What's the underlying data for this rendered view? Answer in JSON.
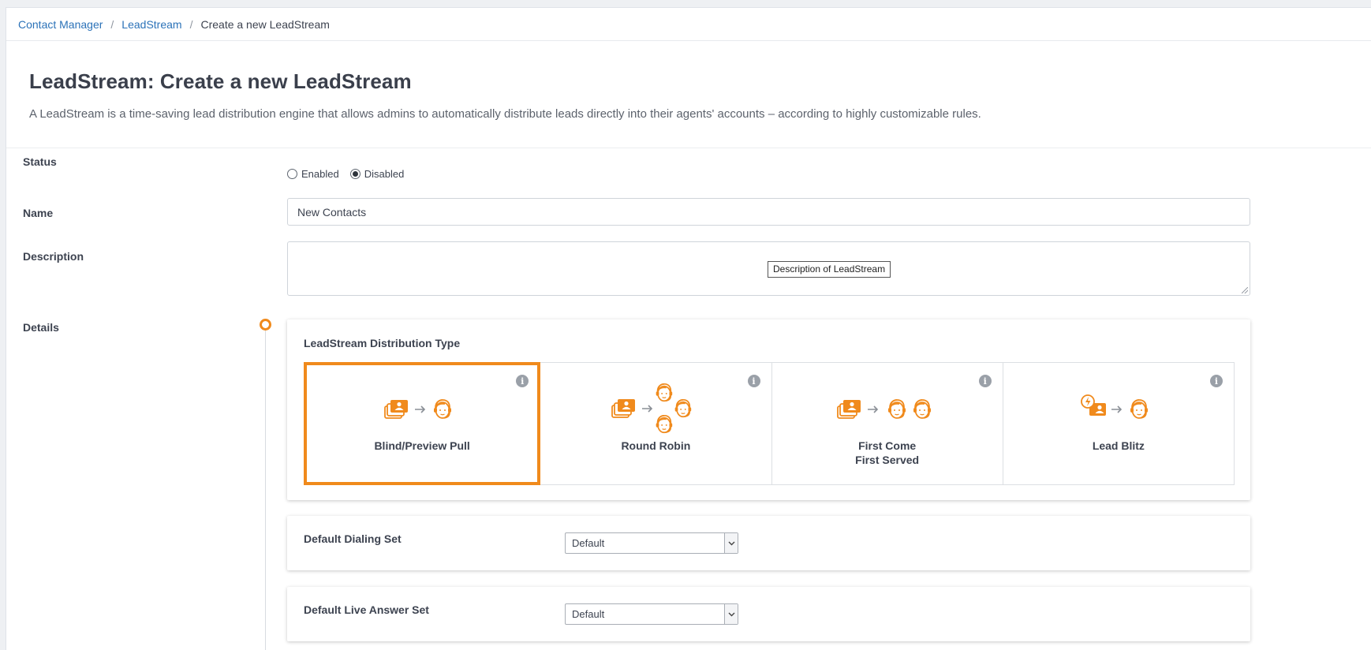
{
  "breadcrumb": {
    "items": [
      "Contact Manager",
      "LeadStream"
    ],
    "current": "Create a new LeadStream"
  },
  "header": {
    "title": "LeadStream: Create a new LeadStream",
    "description": "A LeadStream is a time-saving lead distribution engine that allows admins to automatically distribute leads directly into their agents' accounts – according to highly customizable rules."
  },
  "form": {
    "status": {
      "label": "Status",
      "options": [
        "Enabled",
        "Disabled"
      ],
      "selected": "Disabled"
    },
    "name": {
      "label": "Name",
      "value": "New Contacts"
    },
    "description": {
      "label": "Description",
      "tooltip": "Description of LeadStream"
    },
    "details": {
      "label": "Details"
    }
  },
  "distribution": {
    "title": "LeadStream Distribution Type",
    "selected": "Blind/Preview Pull",
    "types": [
      {
        "line1": "Blind/Preview Pull",
        "line2": "",
        "icon": "contacts-to-agent-icon"
      },
      {
        "line1": "Round Robin",
        "line2": "",
        "icon": "round-robin-icon"
      },
      {
        "line1": "First Come",
        "line2": "First Served",
        "icon": "first-come-first-served-icon"
      },
      {
        "line1": "Lead Blitz",
        "line2": "",
        "icon": "lead-blitz-icon"
      }
    ]
  },
  "dialing_set": {
    "label": "Default Dialing Set",
    "value": "Default"
  },
  "live_answer_set": {
    "label": "Default Live Answer Set",
    "value": "Default"
  },
  "colors": {
    "accent": "#f08a1c",
    "link": "#2b72b8",
    "text": "#3d4350"
  }
}
